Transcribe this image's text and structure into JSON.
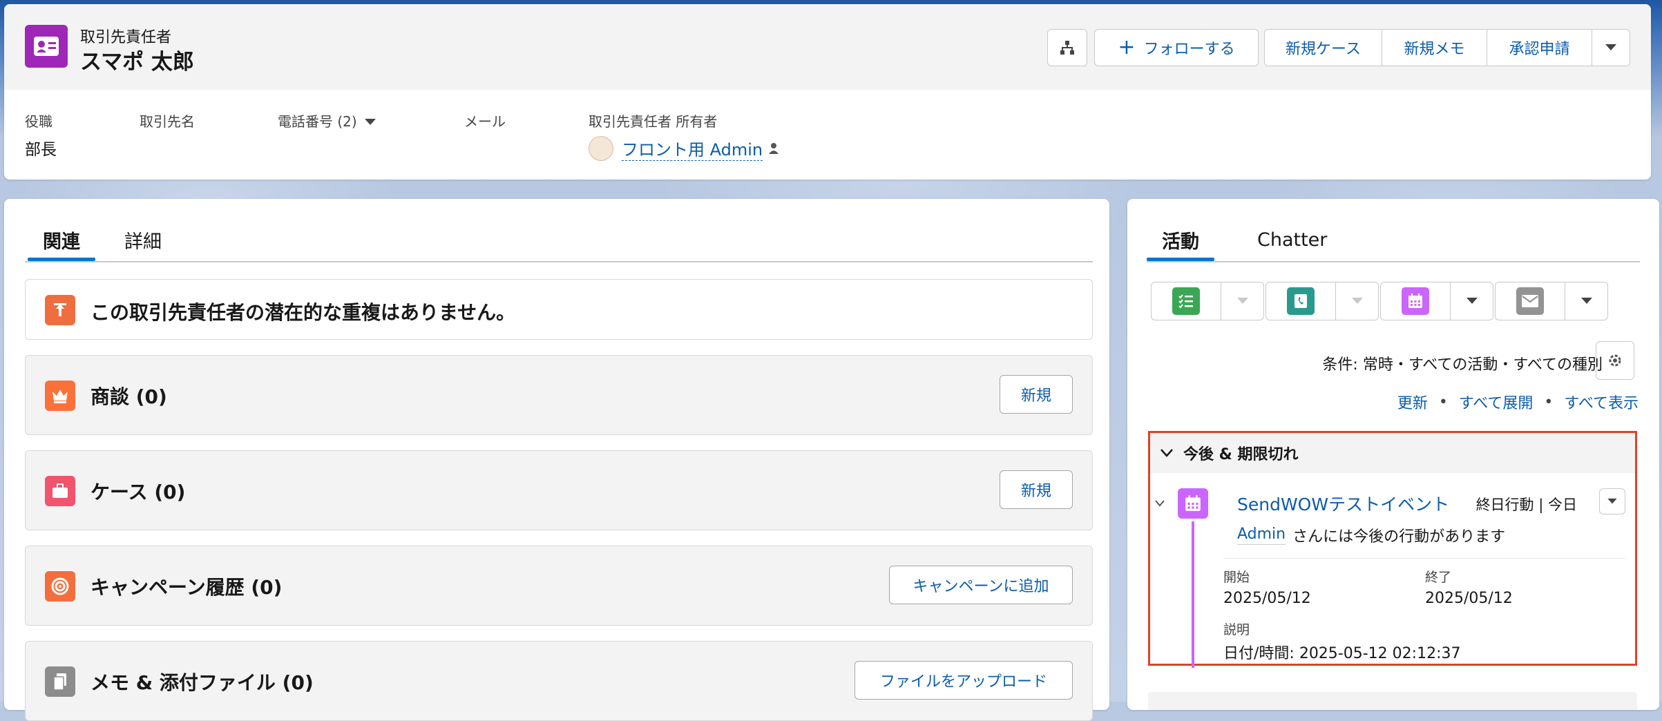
{
  "header": {
    "object_label": "取引先責任者",
    "record_name": "スマポ 太郎",
    "follow_label": "フォローする",
    "actions": [
      "新規ケース",
      "新規メモ",
      "承認申請"
    ]
  },
  "fields": {
    "title_label": "役職",
    "title_value": "部長",
    "account_label": "取引先名",
    "phone_label": "電話番号 (2)",
    "email_label": "メール",
    "owner_label": "取引先責任者 所有者",
    "owner_value": "フロント用 Admin"
  },
  "left": {
    "tabs": [
      "関連",
      "詳細"
    ],
    "duplicate_msg": "この取引先責任者の潜在的な重複はありません。",
    "cards": [
      {
        "title": "商談 (0)",
        "button": "新規"
      },
      {
        "title": "ケース (0)",
        "button": "新規"
      },
      {
        "title": "キャンペーン履歴 (0)",
        "button": "キャンペーンに追加"
      },
      {
        "title": "メモ & 添付ファイル (0)",
        "button": "ファイルをアップロード"
      }
    ]
  },
  "right": {
    "tabs": [
      "活動",
      "Chatter"
    ],
    "filter_text": "条件: 常時・すべての活動・すべての種別",
    "links": [
      "更新",
      "すべて展開",
      "すべて表示"
    ],
    "section_title": "今後 & 期限切れ",
    "event": {
      "title": "SendWOWテストイベント",
      "meta": "終日行動 | 今日",
      "owner_link": "Admin",
      "owner_text": "さんには今後の行動があります",
      "start_label": "開始",
      "start_value": "2025/05/12",
      "end_label": "終了",
      "end_value": "2025/05/12",
      "desc_label": "説明",
      "desc_value": "日付/時間: 2025-05-12 02:12:37"
    }
  },
  "colors": {
    "accent": "#0176d3",
    "link": "#0b5cab",
    "contact_icon": "#9e27b8",
    "highlight_border": "#e0402a"
  }
}
